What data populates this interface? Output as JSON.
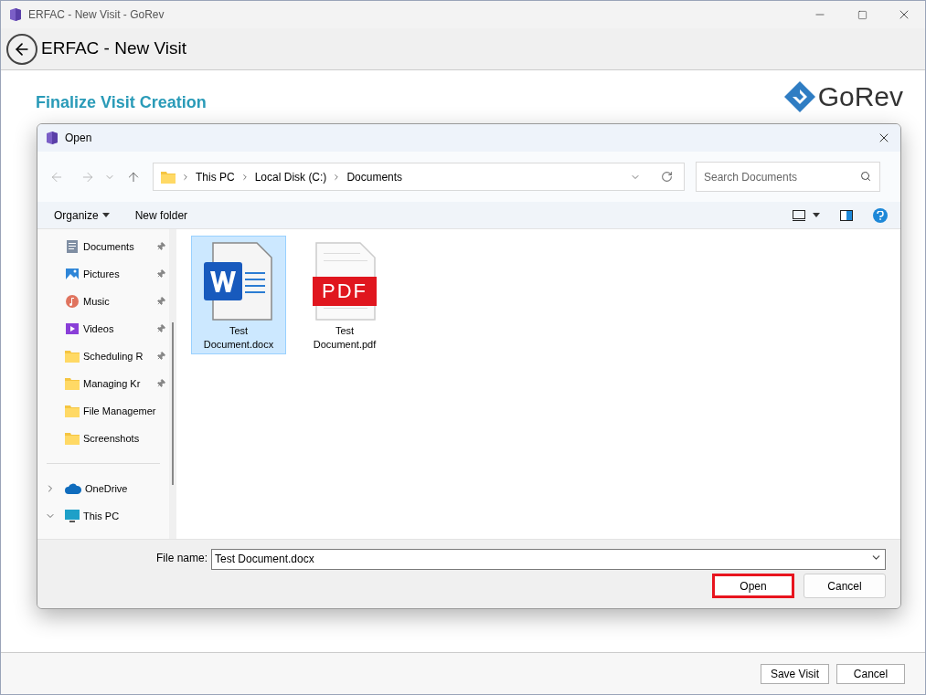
{
  "window": {
    "title": "ERFAC - New Visit - GoRev"
  },
  "header": {
    "title": "ERFAC - New Visit"
  },
  "page": {
    "heading": "Finalize Visit Creation",
    "logo_text": "GoRev"
  },
  "dialog": {
    "title": "Open",
    "breadcrumb": [
      "This PC",
      "Local Disk (C:)",
      "Documents"
    ],
    "search": {
      "placeholder": "Search Documents"
    },
    "commands": [
      {
        "label": "Organize",
        "dropdown": true
      },
      {
        "label": "New folder",
        "dropdown": false
      }
    ],
    "sidebar": [
      {
        "kind": "documents",
        "label": "Documents",
        "pinned": true
      },
      {
        "kind": "pictures",
        "label": "Pictures",
        "pinned": true
      },
      {
        "kind": "music",
        "label": "Music",
        "pinned": true
      },
      {
        "kind": "videos",
        "label": "Videos",
        "pinned": true
      },
      {
        "kind": "folder",
        "label": "Scheduling R",
        "pinned": true
      },
      {
        "kind": "folder",
        "label": "Managing Kr",
        "pinned": true
      },
      {
        "kind": "folder",
        "label": "File Managemer",
        "pinned": false
      },
      {
        "kind": "folder",
        "label": "Screenshots",
        "pinned": false
      }
    ],
    "tree": [
      {
        "kind": "cloud",
        "label": "OneDrive",
        "expanded": false
      },
      {
        "kind": "pc",
        "label": "This PC",
        "expanded": true
      }
    ],
    "files": [
      {
        "kind": "word",
        "name": "Test Document.docx",
        "selected": true
      },
      {
        "kind": "pdf",
        "name": "Test Document.pdf",
        "selected": false,
        "badge": "PDF"
      }
    ],
    "file_name": {
      "label": "File name:",
      "value": "Test Document.docx"
    },
    "buttons": [
      {
        "label": "Open",
        "highlighted": true
      },
      {
        "label": "Cancel",
        "highlighted": false
      }
    ]
  },
  "footer_buttons": [
    "Save Visit",
    "Cancel"
  ]
}
